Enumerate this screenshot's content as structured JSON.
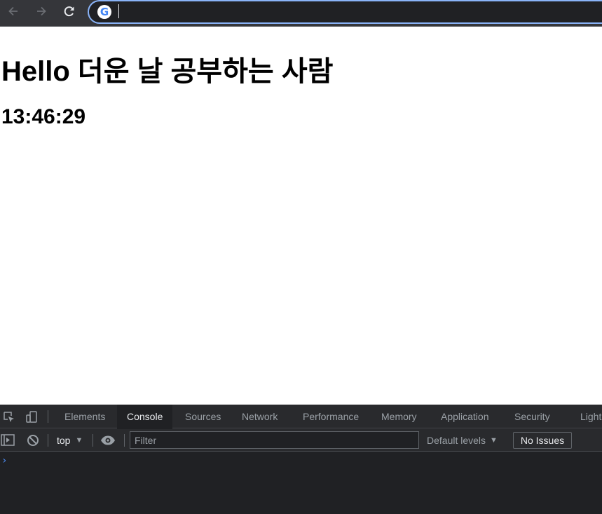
{
  "browser": {
    "back_icon": "arrow-left-icon",
    "forward_icon": "arrow-right-icon",
    "reload_icon": "reload-icon",
    "omnibox": {
      "icon": "google-g-icon",
      "logo_letter": "G",
      "value": ""
    }
  },
  "page": {
    "heading": "Hello 더운 날 공부하는 사람",
    "clock": "13:46:29"
  },
  "devtools": {
    "tabs": [
      "Elements",
      "Console",
      "Sources",
      "Network",
      "Performance",
      "Memory",
      "Application",
      "Security",
      "Light"
    ],
    "active_tab": "Console",
    "toolbar": {
      "context": "top",
      "filter_placeholder": "Filter",
      "levels": "Default levels",
      "issues": "No Issues"
    },
    "prompt": "›"
  },
  "colors": {
    "chrome_bar": "#35363a",
    "devtools_bg": "#202124",
    "accent": "#8ab4f8"
  }
}
